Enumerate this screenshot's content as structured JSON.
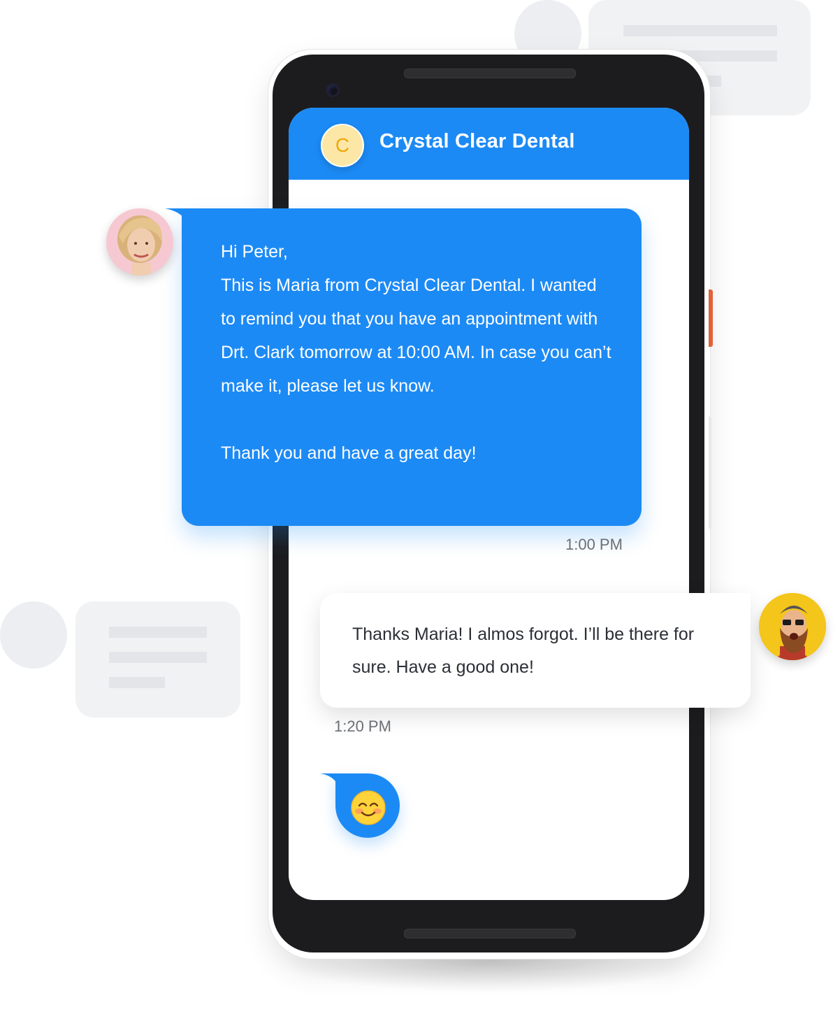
{
  "app": {
    "title": "Crystal Clear Dental",
    "logo_letter": "C"
  },
  "messages": [
    {
      "direction": "incoming",
      "sender_avatar": "female-agent-avatar",
      "lines": [
        "Hi Peter,",
        "This is Maria from Crystal Clear Dental. I wanted to remind you that you have an appointment  with Drt. Clark tomorrow at 10:00 AM. In case you can’t  make it, please let us know."
      ],
      "closing": "Thank you and have a great day!",
      "time": "1:00 PM"
    },
    {
      "direction": "outgoing",
      "sender_avatar": "bearded-man-avatar",
      "text": "Thanks Maria! I almos forgot. I’ll be there for sure. Have a good one!",
      "time": "1:20 PM"
    },
    {
      "direction": "incoming",
      "emoji": "smiling-face-emoji"
    }
  ],
  "colors": {
    "brand_blue": "#1c8af5",
    "logo_bg": "#fde7a6",
    "logo_letter": "#f2a60c",
    "placeholder": "#f1f2f4"
  }
}
